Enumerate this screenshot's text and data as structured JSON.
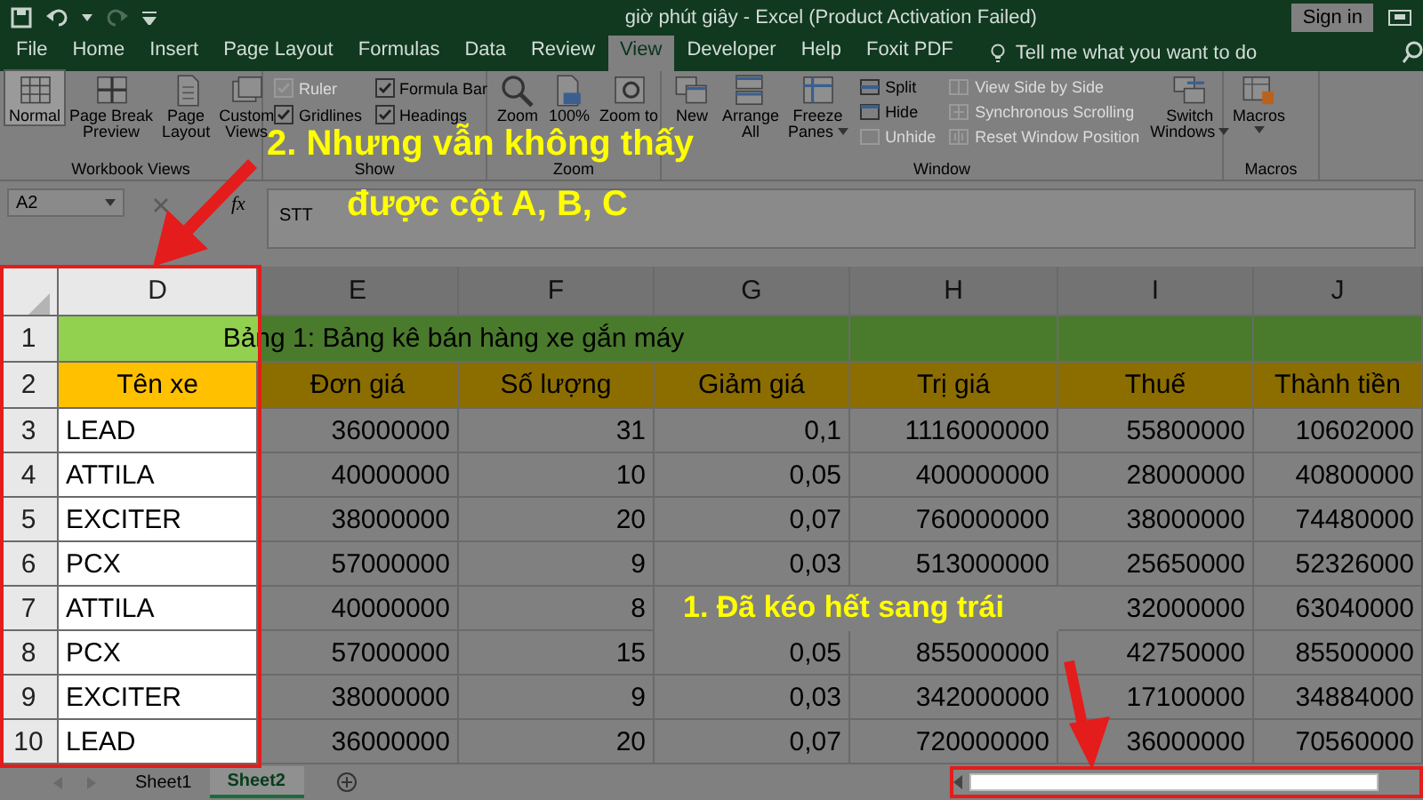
{
  "title_bar": {
    "title": "giờ phút giây  -  Excel (Product Activation Failed)",
    "sign_in": "Sign in"
  },
  "ribbon_tabs": [
    {
      "label": "File",
      "selected": false
    },
    {
      "label": "Home",
      "selected": false
    },
    {
      "label": "Insert",
      "selected": false
    },
    {
      "label": "Page Layout",
      "selected": false
    },
    {
      "label": "Formulas",
      "selected": false
    },
    {
      "label": "Data",
      "selected": false
    },
    {
      "label": "Review",
      "selected": false
    },
    {
      "label": "View",
      "selected": true
    },
    {
      "label": "Developer",
      "selected": false
    },
    {
      "label": "Help",
      "selected": false
    },
    {
      "label": "Foxit PDF",
      "selected": false
    }
  ],
  "tell_me": "Tell me what you want to do",
  "ribbon_groups": [
    {
      "label": "Workbook Views",
      "items": [
        {
          "kind": "big",
          "label": "Normal",
          "selected": true
        },
        {
          "kind": "big",
          "label": "Page Break\nPreview",
          "selected": false
        },
        {
          "kind": "big",
          "label": "Page\nLayout",
          "selected": false
        },
        {
          "kind": "big",
          "label": "Custom\nViews",
          "selected": false
        }
      ]
    },
    {
      "label": "Show",
      "items": [
        {
          "kind": "stack",
          "items": [
            {
              "kind": "check",
              "label": "Ruler",
              "checked": true,
              "disabled": true
            },
            {
              "kind": "check",
              "label": "Gridlines",
              "checked": true,
              "disabled": false
            }
          ]
        },
        {
          "kind": "stack",
          "items": [
            {
              "kind": "check",
              "label": "Formula Bar",
              "checked": true,
              "disabled": false
            },
            {
              "kind": "check",
              "label": "Headings",
              "checked": true,
              "disabled": false
            }
          ]
        }
      ]
    },
    {
      "label": "Zoom",
      "items": [
        {
          "kind": "big",
          "label": "Zoom",
          "selected": false
        },
        {
          "kind": "big",
          "label": "100%",
          "selected": false
        },
        {
          "kind": "big",
          "label": "Zoom to",
          "selected": false
        }
      ]
    },
    {
      "label": "Window",
      "items": [
        {
          "kind": "big",
          "label": "New",
          "selected": false
        },
        {
          "kind": "big",
          "label": "Arrange\nAll",
          "selected": false
        },
        {
          "kind": "big",
          "label": "Freeze\nPanes",
          "selected": false,
          "dropdown": true
        },
        {
          "kind": "stack",
          "items": [
            {
              "kind": "small",
              "label": "Split",
              "disabled": false
            },
            {
              "kind": "small",
              "label": "Hide",
              "disabled": false
            },
            {
              "kind": "small",
              "label": "Unhide",
              "disabled": true
            }
          ]
        },
        {
          "kind": "stack",
          "items": [
            {
              "kind": "small",
              "label": "View Side by Side",
              "disabled": true
            },
            {
              "kind": "small",
              "label": "Synchronous Scrolling",
              "disabled": true
            },
            {
              "kind": "small",
              "label": "Reset Window Position",
              "disabled": true
            }
          ]
        },
        {
          "kind": "big",
          "label": "Switch\nWindows",
          "selected": false,
          "dropdown": true
        }
      ]
    },
    {
      "label": "Macros",
      "items": [
        {
          "kind": "big",
          "label": "Macros",
          "selected": false,
          "dropdown": true
        }
      ]
    }
  ],
  "formula_bar": {
    "name_box": "A2",
    "function_label": "fx",
    "value": "STT"
  },
  "sheet": {
    "columns": [
      {
        "label": "D",
        "kind": "text",
        "highlighted": true
      },
      {
        "label": "E",
        "kind": "number",
        "highlighted": false
      },
      {
        "label": "F",
        "kind": "number",
        "highlighted": false
      },
      {
        "label": "G",
        "kind": "number",
        "highlighted": false
      },
      {
        "label": "H",
        "kind": "number",
        "highlighted": false
      },
      {
        "label": "I",
        "kind": "number",
        "highlighted": false
      },
      {
        "label": "J",
        "kind": "number",
        "highlighted": false
      }
    ],
    "rows": [
      {
        "header": "1",
        "kind": "title",
        "text": "Bảng 1: Bảng kê bán hàng xe gắn máy"
      },
      {
        "header": "2",
        "kind": "header",
        "cells": [
          "Tên xe",
          "Đơn giá",
          "Số lượng",
          "Giảm giá",
          "Trị giá",
          "Thuế",
          "Thành tiền"
        ]
      },
      {
        "header": "3",
        "kind": "data",
        "cells": [
          "LEAD",
          "36000000",
          "31",
          "0,1",
          "1116000000",
          "55800000",
          "10602000"
        ]
      },
      {
        "header": "4",
        "kind": "data",
        "cells": [
          "ATTILA",
          "40000000",
          "10",
          "0,05",
          "400000000",
          "28000000",
          "40800000"
        ]
      },
      {
        "header": "5",
        "kind": "data",
        "cells": [
          "EXCITER",
          "38000000",
          "20",
          "0,07",
          "760000000",
          "38000000",
          "74480000"
        ]
      },
      {
        "header": "6",
        "kind": "data",
        "cells": [
          "PCX",
          "57000000",
          "9",
          "0,03",
          "513000000",
          "25650000",
          "52326000"
        ]
      },
      {
        "header": "7",
        "kind": "data",
        "cells": [
          "ATTILA",
          "40000000",
          "8",
          null,
          null,
          "32000000",
          "63040000"
        ]
      },
      {
        "header": "8",
        "kind": "data",
        "cells": [
          "PCX",
          "57000000",
          "15",
          "0,05",
          "855000000",
          "42750000",
          "85500000"
        ]
      },
      {
        "header": "9",
        "kind": "data",
        "cells": [
          "EXCITER",
          "38000000",
          "9",
          "0,03",
          "342000000",
          "17100000",
          "34884000"
        ]
      },
      {
        "header": "10",
        "kind": "data",
        "cells": [
          "LEAD",
          "36000000",
          "20",
          "0,07",
          "720000000",
          "36000000",
          "70560000"
        ]
      }
    ]
  },
  "sheet_tabs": [
    {
      "label": "Sheet1",
      "selected": false
    },
    {
      "label": "Sheet2",
      "selected": true
    }
  ],
  "scroll_bar": {
    "highlighted": true
  },
  "annotations": [
    {
      "lines": [
        "2. Nhưng vẫn không thấy",
        "được cột A, B, C"
      ]
    },
    {
      "lines": [
        "1. Đã kéo hết sang trái"
      ]
    }
  ]
}
